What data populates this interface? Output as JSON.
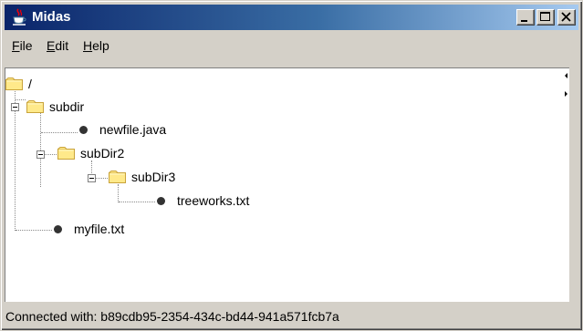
{
  "window": {
    "title": "Midas"
  },
  "title_buttons": [
    "minimize",
    "maximize",
    "close"
  ],
  "menu": {
    "file": {
      "mnemonic": "F",
      "rest": "ile"
    },
    "edit": {
      "mnemonic": "E",
      "rest": "dit"
    },
    "help": {
      "mnemonic": "H",
      "rest": "elp"
    }
  },
  "tree": {
    "root": "/",
    "subdir": "subdir",
    "newfile": "newfile.java",
    "subdir2": "subDir2",
    "subdir3": "subDir3",
    "treeworks": "treeworks.txt",
    "myfile": "myfile.txt"
  },
  "status": {
    "text": "Connected with: b89cdb95-2354-434c-bd44-941a571fcb7a"
  },
  "colors": {
    "titlebar_start": "#0a246a",
    "titlebar_end": "#a6caf0",
    "folder": "#ffe98a",
    "chrome": "#d4d0c8"
  }
}
